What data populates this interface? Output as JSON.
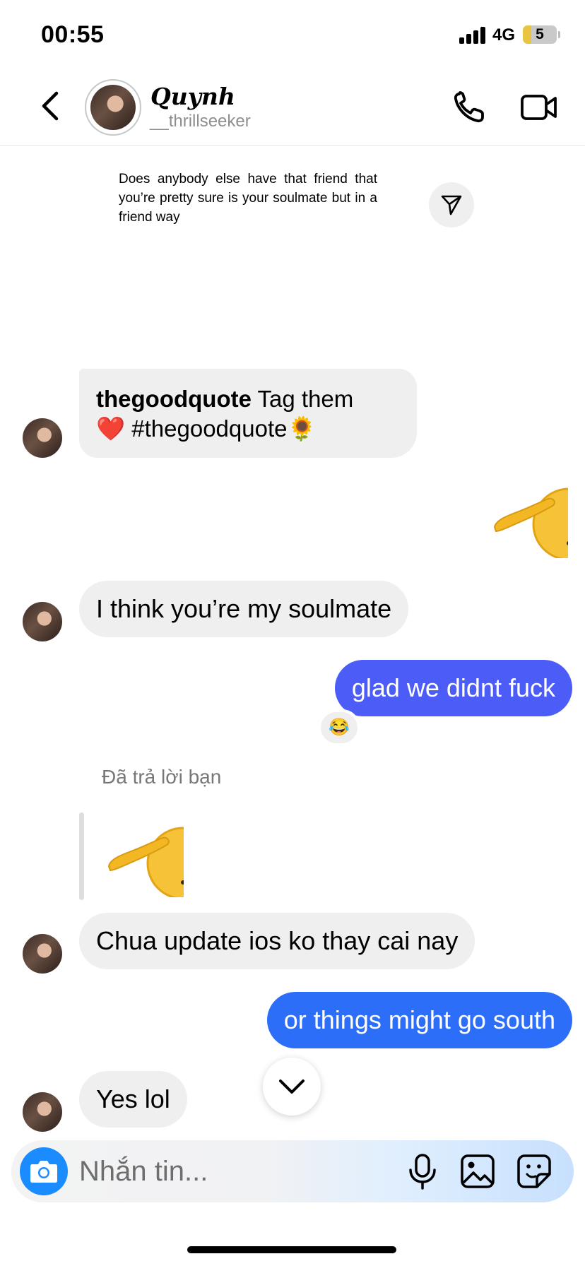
{
  "status_bar": {
    "time": "00:55",
    "network": "4G",
    "battery": "5",
    "battery_level": 0.05
  },
  "header": {
    "contact_name": "Quynh",
    "username": "__thrillseeker",
    "icons": [
      "chevron-left-icon",
      "phone-icon",
      "video-camera-icon"
    ]
  },
  "shared_post": {
    "text": "Does anybody else have that friend that you’re pretty sure is your soulmate but in a friend way",
    "share_icon": "send-icon"
  },
  "caption": {
    "account": "thegoodquote",
    "text_line1": "Tag them",
    "heart": "❤️",
    "hashtag": "#thegoodquote",
    "emoji": "🌻"
  },
  "messages": {
    "soulmate": "I think you’re my soulmate",
    "glad": "glad we didnt fuck",
    "glad_reaction": "😂",
    "replied_label": "Đã trả lời bạn",
    "chua_update": "Chua update ios ko thay cai nay",
    "south": "or things might go south",
    "yes_lol": "Yes lol"
  },
  "composer": {
    "placeholder": "Nhắn tin...",
    "icons": [
      "camera-icon",
      "microphone-icon",
      "image-icon",
      "sticker-icon"
    ]
  },
  "colors": {
    "outgoing_purple": "#4c5cf6",
    "outgoing_blue": "#2d6ef8",
    "incoming": "#efefef",
    "camera": "#1a8cff"
  }
}
